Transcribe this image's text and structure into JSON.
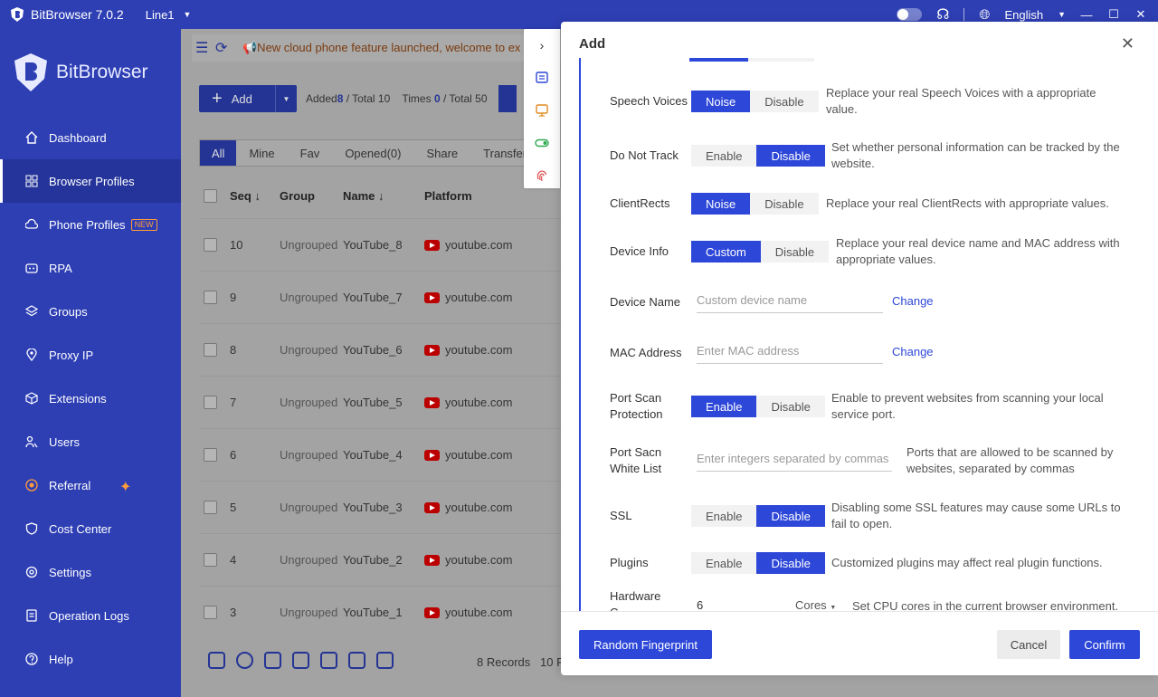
{
  "titlebar": {
    "app_title": "BitBrowser 7.0.2",
    "line": "Line1",
    "language": "English"
  },
  "sidebar": {
    "brand": "BitBrowser",
    "items": [
      {
        "label": "Dashboard",
        "icon": "home-icon"
      },
      {
        "label": "Browser Profiles",
        "icon": "grid-icon",
        "active": true
      },
      {
        "label": "Phone Profiles",
        "icon": "cloud-phone-icon",
        "badge": "NEW"
      },
      {
        "label": "RPA",
        "icon": "rpa-icon"
      },
      {
        "label": "Groups",
        "icon": "layers-icon"
      },
      {
        "label": "Proxy IP",
        "icon": "location-icon"
      },
      {
        "label": "Extensions",
        "icon": "cube-icon"
      },
      {
        "label": "Users",
        "icon": "users-icon"
      },
      {
        "label": "Referral",
        "icon": "referral-icon"
      },
      {
        "label": "Cost Center",
        "icon": "shield-icon"
      },
      {
        "label": "Settings",
        "icon": "gear-icon"
      },
      {
        "label": "Operation Logs",
        "icon": "log-icon"
      },
      {
        "label": "Help",
        "icon": "help-icon"
      }
    ]
  },
  "main": {
    "notice": "📢New cloud phone feature launched, welcome to ex",
    "add_label": "Add",
    "counts": {
      "added_label": "Added",
      "added": "8",
      "total_label": "/ Total",
      "total": "10",
      "times_label": "Times",
      "times": "0",
      "times_total_label": "/ Total",
      "times_total": "50"
    },
    "tabs": [
      "All",
      "Mine",
      "Fav",
      "Opened(0)",
      "Share",
      "Transfer"
    ],
    "columns": {
      "seq": "Seq ↓",
      "group": "Group",
      "name": "Name ↓",
      "platform": "Platform"
    },
    "rows": [
      {
        "seq": "10",
        "group": "Ungrouped",
        "name": "YouTube_8",
        "platform": "youtube.com"
      },
      {
        "seq": "9",
        "group": "Ungrouped",
        "name": "YouTube_7",
        "platform": "youtube.com"
      },
      {
        "seq": "8",
        "group": "Ungrouped",
        "name": "YouTube_6",
        "platform": "youtube.com"
      },
      {
        "seq": "7",
        "group": "Ungrouped",
        "name": "YouTube_5",
        "platform": "youtube.com"
      },
      {
        "seq": "6",
        "group": "Ungrouped",
        "name": "YouTube_4",
        "platform": "youtube.com"
      },
      {
        "seq": "5",
        "group": "Ungrouped",
        "name": "YouTube_3",
        "platform": "youtube.com"
      },
      {
        "seq": "4",
        "group": "Ungrouped",
        "name": "YouTube_2",
        "platform": "youtube.com"
      },
      {
        "seq": "3",
        "group": "Ungrouped",
        "name": "YouTube_1",
        "platform": "youtube.com"
      }
    ],
    "records": "8 Records",
    "page_size": "10 R"
  },
  "dialog": {
    "title": "Add",
    "settings": {
      "speech": {
        "label": "Speech Voices",
        "opt1": "Noise",
        "opt2": "Disable",
        "desc": "Replace your real Speech Voices with a appropriate value."
      },
      "dnt": {
        "label": "Do Not Track",
        "opt1": "Enable",
        "opt2": "Disable",
        "desc": "Set whether personal information can be tracked by the website."
      },
      "clientrects": {
        "label": "ClientRects",
        "opt1": "Noise",
        "opt2": "Disable",
        "desc": "Replace your real ClientRects with appropriate values."
      },
      "deviceinfo": {
        "label": "Device Info",
        "opt1": "Custom",
        "opt2": "Disable",
        "desc": "Replace your real device name and MAC address with appropriate values."
      },
      "devicename": {
        "label": "Device Name",
        "placeholder": "Custom device name",
        "action": "Change"
      },
      "mac": {
        "label": "MAC Address",
        "placeholder": "Enter MAC address",
        "action": "Change"
      },
      "portscan": {
        "label": "Port Scan Protection",
        "opt1": "Enable",
        "opt2": "Disable",
        "desc": "Enable to prevent websites from scanning your local service port."
      },
      "whitelist": {
        "label": "Port Sacn White List",
        "placeholder": "Enter integers separated by commas",
        "desc": "Ports that are allowed to be scanned by websites, separated by commas"
      },
      "ssl": {
        "label": "SSL",
        "opt1": "Enable",
        "opt2": "Disable",
        "desc": "Disabling some SSL features may cause some URLs to fail to open."
      },
      "plugins": {
        "label": "Plugins",
        "opt1": "Enable",
        "opt2": "Disable",
        "desc": "Customized plugins may affect real plugin functions."
      },
      "hardware": {
        "label": "Hardware C",
        "value": "6",
        "unit": "Cores",
        "desc": "Set CPU cores in the current browser environment."
      }
    },
    "buttons": {
      "random": "Random Fingerprint",
      "cancel": "Cancel",
      "confirm": "Confirm"
    }
  },
  "colors": {
    "primary": "#2d47d8",
    "sidebar": "#2e3fb4",
    "accent_orange": "#ff9b3b"
  }
}
